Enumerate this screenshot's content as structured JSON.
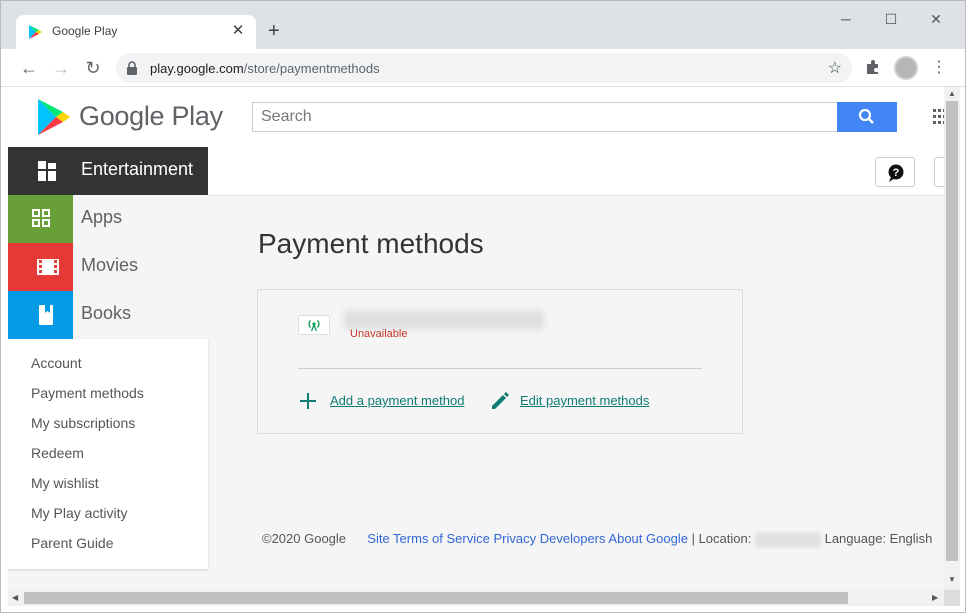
{
  "browser": {
    "tab_title": "Google Play",
    "tab_close": "✕",
    "new_tab": "+",
    "url_host": "play.google.com",
    "url_path": "/store/paymentmethods",
    "window_controls": [
      "─",
      "☐",
      "✕"
    ]
  },
  "header": {
    "logo_text": "Google Play",
    "search_placeholder": "Search"
  },
  "sidebar": {
    "categories": [
      {
        "label": "Entertainment",
        "color": "#333333"
      },
      {
        "label": "Apps",
        "color": "#689f38"
      },
      {
        "label": "Movies",
        "color": "#e53935"
      },
      {
        "label": "Books",
        "color": "#039be5"
      }
    ],
    "nav": [
      "Account",
      "Payment methods",
      "My subscriptions",
      "Redeem",
      "My wishlist",
      "My Play activity",
      "Parent Guide"
    ]
  },
  "main": {
    "title": "Payment methods",
    "payment_status": "Unavailable",
    "add_label": "Add a payment method",
    "edit_label": "Edit payment methods"
  },
  "footer": {
    "copyright": "©2020 Google",
    "links": [
      "Site Terms of Service",
      "Privacy",
      "Developers",
      "About Google"
    ],
    "separator": "|",
    "location_label": "Location:",
    "language_label": "Language: English"
  }
}
